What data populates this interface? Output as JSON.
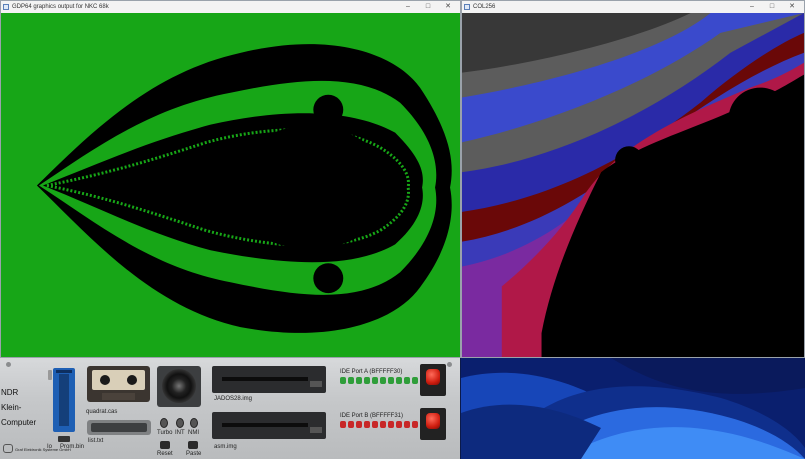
{
  "windows": {
    "gdp": {
      "title": "GDP64 graphics output for NKC 68k",
      "controls": [
        "–",
        "□",
        "✕"
      ]
    },
    "col": {
      "title": "COL256",
      "controls": [
        "–",
        "□",
        "✕"
      ]
    }
  },
  "emulator": {
    "title_lines": [
      "NDR",
      "Klein-",
      "Computer"
    ],
    "company": "Graf Elektronik Systeme GmbH",
    "switch_labels": [
      "Io",
      "Prom.bin"
    ],
    "cassette_file": "quadrat.cas",
    "serial_file": "list.txt",
    "toggles": [
      "Turbo",
      "INT",
      "NMI"
    ],
    "buttons": [
      "Reset",
      "Paste"
    ],
    "drive_a_file": "JADOS28.img",
    "drive_b_file": "asm.img",
    "ide_a": "IDE Port A (BFFFFF30)",
    "ide_b": "IDE Port B (BFFFFF31)"
  },
  "colors": {
    "gdp_green": "#17a617",
    "gdp_black": "#000000",
    "col_bands": [
      "#383838",
      "#5c5c5c",
      "#3a4acc",
      "#2a2aa8",
      "#6a0808",
      "#9c1a28",
      "#b01848",
      "#7a2aa0"
    ],
    "led_green": "#2f9e3a",
    "led_red": "#c82828"
  }
}
